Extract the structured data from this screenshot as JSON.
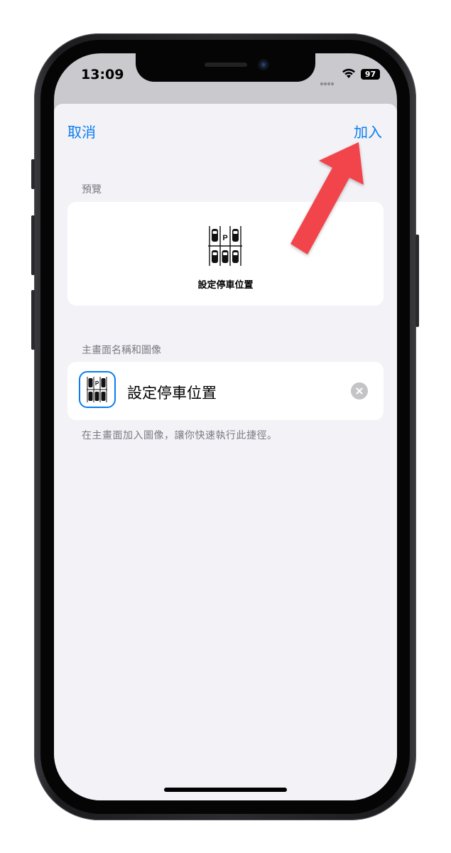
{
  "status_bar": {
    "time": "13:09",
    "battery": "97"
  },
  "nav": {
    "cancel_label": "取消",
    "add_label": "加入"
  },
  "preview": {
    "section_label": "預覽",
    "shortcut_name": "設定停車位置"
  },
  "home_screen": {
    "section_label": "主畫面名稱和圖像",
    "name_value": "設定停車位置",
    "footnote": "在主畫面加入圖像，讓你快速執行此捷徑。"
  },
  "icon_glyph": "P",
  "colors": {
    "accent": "#0a7cf0",
    "sheet_background": "#f2f2f7",
    "annotation_arrow": "#f2444c"
  }
}
